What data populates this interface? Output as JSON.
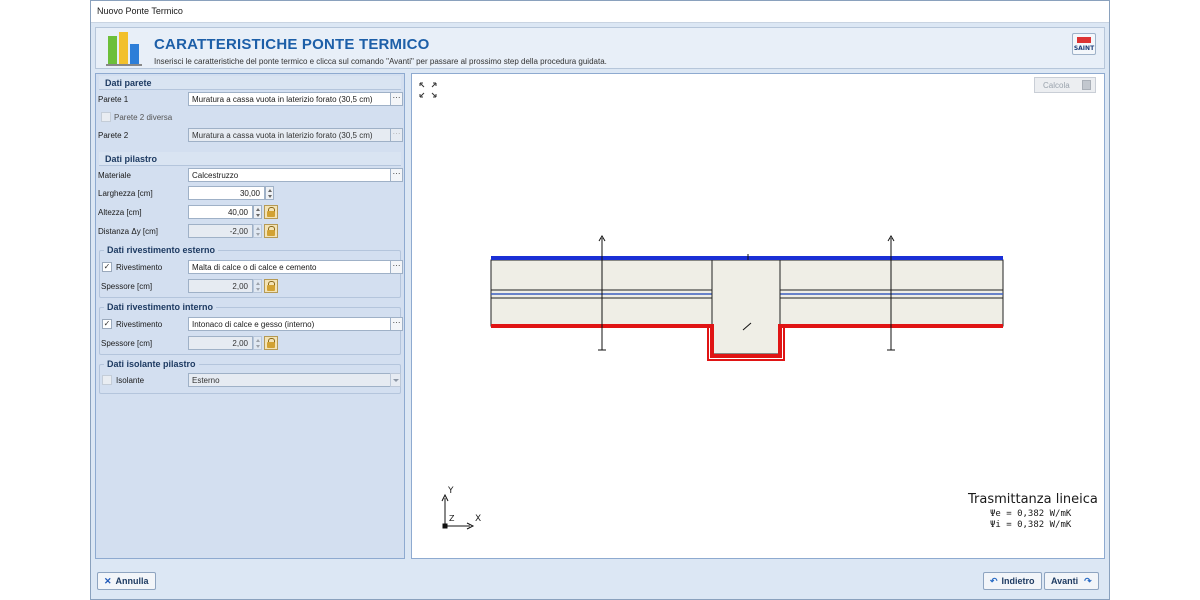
{
  "window": {
    "title": "Nuovo Ponte Termico"
  },
  "header": {
    "title": "CARATTERISTICHE PONTE TERMICO",
    "subtitle": "Inserisci le caratteristiche del ponte termico e clicca sul comando \"Avanti\" per passare al prossimo step della procedura guidata.",
    "help_icon": "saint-logo-icon"
  },
  "dati_parete": {
    "title": "Dati parete",
    "parete1_label": "Parete 1",
    "parete1_value": "Muratura a cassa vuota in laterizio forato (30,5 cm)",
    "parete2_diversa_label": "Parete 2 diversa",
    "parete2_diversa_checked": false,
    "parete2_label": "Parete 2",
    "parete2_value": "Muratura a cassa vuota in laterizio forato (30,5 cm)"
  },
  "dati_pilastro": {
    "title": "Dati pilastro",
    "materiale_label": "Materiale",
    "materiale_value": "Calcestruzzo",
    "larghezza_label": "Larghezza [cm]",
    "larghezza_value": "30,00",
    "altezza_label": "Altezza [cm]",
    "altezza_value": "40,00",
    "distanza_label": "Distanza Δy [cm]",
    "distanza_value": "-2,00"
  },
  "rivestimento_esterno": {
    "title": "Dati rivestimento esterno",
    "rivestimento_label": "Rivestimento",
    "rivestimento_checked": true,
    "rivestimento_value": "Malta di calce o di calce e cemento",
    "spessore_label": "Spessore [cm]",
    "spessore_value": "2,00"
  },
  "rivestimento_interno": {
    "title": "Dati rivestimento interno",
    "rivestimento_label": "Rivestimento",
    "rivestimento_checked": true,
    "rivestimento_value": "Intonaco di calce e gesso (interno)",
    "spessore_label": "Spessore [cm]",
    "spessore_value": "2,00"
  },
  "isolante_pilastro": {
    "title": "Dati isolante pilastro",
    "isolante_label": "Isolante",
    "isolante_checked": false,
    "isolante_value": "Esterno"
  },
  "canvas": {
    "calcola_label": "Calcola",
    "axis_y": "Y",
    "axis_x": "X",
    "axis_z": "Z",
    "result_title": "Trasmittanza lineica",
    "psi_e": "Ψe = 0,382 W/mK",
    "psi_i": "Ψi = 0,382 W/mK",
    "colors": {
      "external": "#1a2fd6",
      "internal": "#e01414",
      "wall": "#efeee6"
    }
  },
  "footer": {
    "annulla_label": "Annulla",
    "indietro_label": "Indietro",
    "avanti_label": "Avanti"
  }
}
